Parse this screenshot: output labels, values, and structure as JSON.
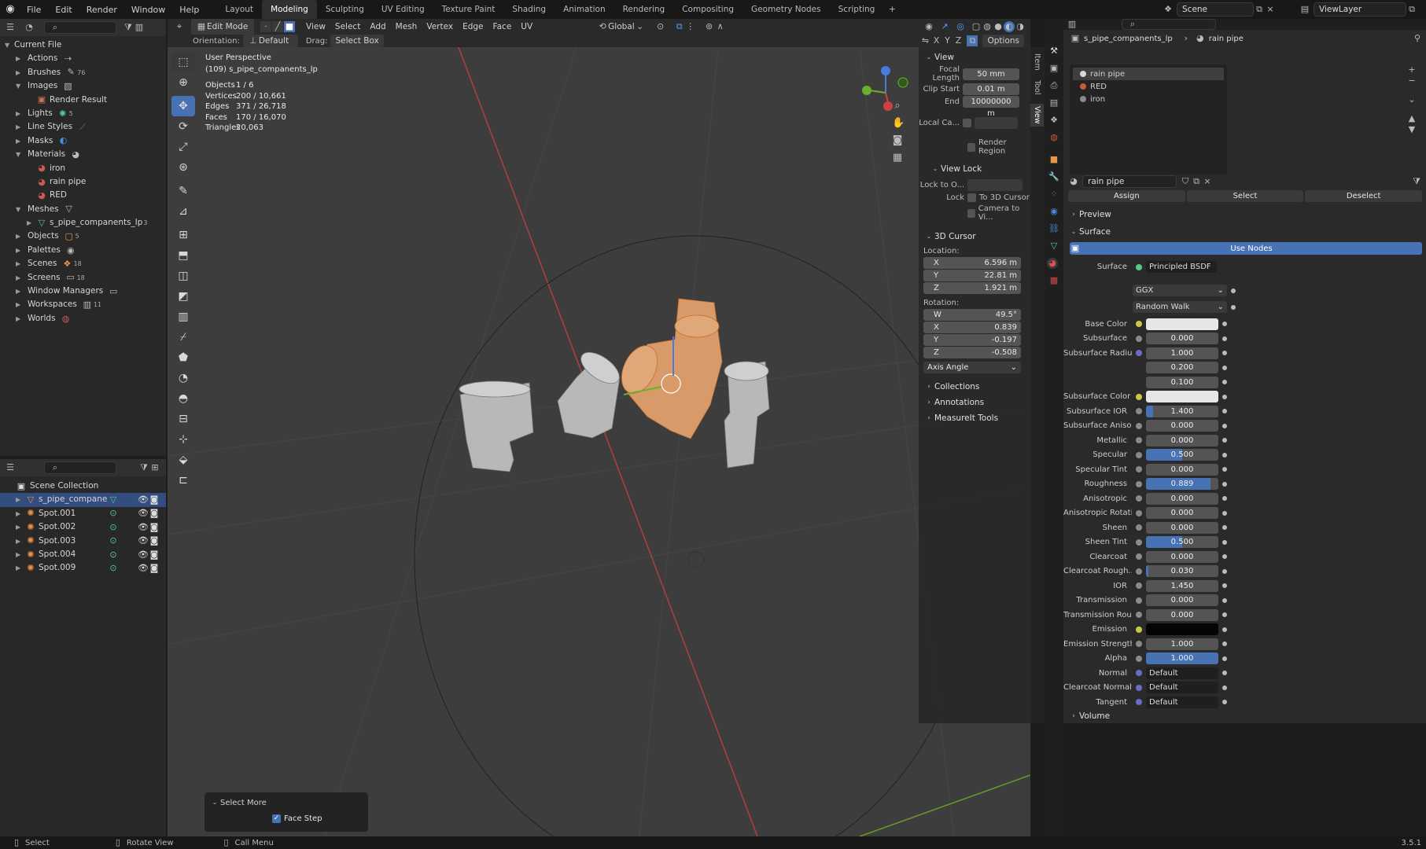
{
  "menu": [
    "File",
    "Edit",
    "Render",
    "Window",
    "Help"
  ],
  "workspaces": [
    {
      "label": "Layout",
      "active": false
    },
    {
      "label": "Modeling",
      "active": true
    },
    {
      "label": "Sculpting",
      "active": false
    },
    {
      "label": "UV Editing",
      "active": false
    },
    {
      "label": "Texture Paint",
      "active": false
    },
    {
      "label": "Shading",
      "active": false
    },
    {
      "label": "Animation",
      "active": false
    },
    {
      "label": "Rendering",
      "active": false
    },
    {
      "label": "Compositing",
      "active": false
    },
    {
      "label": "Geometry Nodes",
      "active": false
    },
    {
      "label": "Scripting",
      "active": false
    }
  ],
  "scene": "Scene",
  "view_layer": "ViewLayer",
  "outliner_top": {
    "root": "Current File",
    "items": [
      {
        "label": "Actions",
        "depth": 1,
        "open": false,
        "badge": ""
      },
      {
        "label": "Brushes",
        "depth": 1,
        "open": false,
        "badge": "76"
      },
      {
        "label": "Images",
        "depth": 1,
        "open": true,
        "badge": ""
      },
      {
        "label": "Render Result",
        "depth": 2,
        "open": null,
        "badge": ""
      },
      {
        "label": "Lights",
        "depth": 1,
        "open": false,
        "badge": "5"
      },
      {
        "label": "Line Styles",
        "depth": 1,
        "open": false,
        "badge": ""
      },
      {
        "label": "Masks",
        "depth": 1,
        "open": false,
        "badge": ""
      },
      {
        "label": "Materials",
        "depth": 1,
        "open": true,
        "badge": ""
      },
      {
        "label": "iron",
        "depth": 2,
        "open": null,
        "badge": ""
      },
      {
        "label": "rain pipe",
        "depth": 2,
        "open": null,
        "badge": ""
      },
      {
        "label": "RED",
        "depth": 2,
        "open": null,
        "badge": ""
      },
      {
        "label": "Meshes",
        "depth": 1,
        "open": true,
        "badge": ""
      },
      {
        "label": "s_pipe_companents_lp",
        "depth": 2,
        "open": false,
        "badge": "3"
      },
      {
        "label": "Objects",
        "depth": 1,
        "open": false,
        "badge": "5"
      },
      {
        "label": "Palettes",
        "depth": 1,
        "open": false,
        "badge": ""
      },
      {
        "label": "Scenes",
        "depth": 1,
        "open": false,
        "badge": "18"
      },
      {
        "label": "Screens",
        "depth": 1,
        "open": false,
        "badge": "18"
      },
      {
        "label": "Window Managers",
        "depth": 1,
        "open": false,
        "badge": ""
      },
      {
        "label": "Workspaces",
        "depth": 1,
        "open": false,
        "badge": "11"
      },
      {
        "label": "Worlds",
        "depth": 1,
        "open": false,
        "badge": ""
      }
    ]
  },
  "outliner_bottom": {
    "root": "Scene Collection",
    "items": [
      {
        "label": "s_pipe_companents_lp",
        "selected": true
      },
      {
        "label": "Spot.001",
        "selected": false
      },
      {
        "label": "Spot.002",
        "selected": false
      },
      {
        "label": "Spot.003",
        "selected": false
      },
      {
        "label": "Spot.004",
        "selected": false
      },
      {
        "label": "Spot.009",
        "selected": false
      }
    ]
  },
  "viewport_header": {
    "mode": "Edit Mode",
    "menus": [
      "View",
      "Select",
      "Add",
      "Mesh",
      "Vertex",
      "Edge",
      "Face",
      "UV"
    ],
    "transform": "Global",
    "orientation_label": "Orientation:",
    "orientation": "Default",
    "drag_label": "Drag:",
    "drag": "Select Box",
    "options": "Options",
    "axes": [
      "X",
      "Y",
      "Z"
    ]
  },
  "overlay_info": {
    "title": "User Perspective",
    "subtitle": "(109) s_pipe_companents_lp",
    "stats": [
      {
        "label": "Objects",
        "value": "1 / 6"
      },
      {
        "label": "Vertices",
        "value": "200 / 10,661"
      },
      {
        "label": "Edges",
        "value": "371 / 26,718"
      },
      {
        "label": "Faces",
        "value": "170 / 16,070"
      },
      {
        "label": "Triangles",
        "value": "20,063"
      }
    ]
  },
  "npanel": {
    "tabs": [
      "Item",
      "Tool",
      "View"
    ],
    "view_section": "View",
    "focal_length_label": "Focal Length",
    "focal_length": "50 mm",
    "clip_start_label": "Clip Start",
    "clip_start": "0.01 m",
    "clip_end_label": "End",
    "clip_end": "10000000 m",
    "local_camera_label": "Local Ca...",
    "render_region": "Render Region",
    "view_lock_section": "View Lock",
    "lock_to_object_label": "Lock to O...",
    "lock_label": "Lock",
    "to_3d_cursor": "To 3D Cursor",
    "camera_to_view": "Camera to Vi...",
    "cursor_section": "3D Cursor",
    "location_label": "Location:",
    "location": [
      {
        "axis": "X",
        "value": "6.596 m"
      },
      {
        "axis": "Y",
        "value": "22.81 m"
      },
      {
        "axis": "Z",
        "value": "1.921 m"
      }
    ],
    "rotation_label": "Rotation:",
    "rotation": [
      {
        "axis": "W",
        "value": "49.5°"
      },
      {
        "axis": "X",
        "value": "0.839"
      },
      {
        "axis": "Y",
        "value": "-0.197"
      },
      {
        "axis": "Z",
        "value": "-0.508"
      }
    ],
    "rotation_mode": "Axis Angle",
    "collapsed": [
      "Collections",
      "Annotations",
      "MeasureIt Tools"
    ]
  },
  "operator_panel": {
    "title": "Select More",
    "option": "Face Step",
    "checked": true
  },
  "properties": {
    "breadcrumb": [
      "s_pipe_companents_lp",
      "rain pipe"
    ],
    "slots": [
      {
        "label": "rain pipe",
        "color": "#d8d8d8",
        "active": true
      },
      {
        "label": "RED",
        "color": "#c85a3a",
        "active": false
      },
      {
        "label": "iron",
        "color": "#8a8a8a",
        "active": false
      }
    ],
    "material_name": "rain pipe",
    "assign": "Assign",
    "select": "Select",
    "deselect": "Deselect",
    "preview": "Preview",
    "surface_section": "Surface",
    "use_nodes": "Use Nodes",
    "surface_label": "Surface",
    "surface_shader": "Principled BSDF",
    "distribution": "GGX",
    "subsurface_method": "Random Walk",
    "fields": [
      {
        "label": "Base Color",
        "kind": "color",
        "color": "#e6e6e6",
        "dot": "#c8c84a"
      },
      {
        "label": "Subsurface",
        "kind": "num",
        "value": "0.000",
        "fill": 0,
        "dot": "#8a8a8a"
      },
      {
        "label": "Subsurface Radius",
        "kind": "num",
        "value": "1.000",
        "fill": 0,
        "dot": "#6a6ac8"
      },
      {
        "label": "",
        "kind": "num",
        "value": "0.200",
        "fill": 0,
        "dot": ""
      },
      {
        "label": "",
        "kind": "num",
        "value": "0.100",
        "fill": 0,
        "dot": ""
      },
      {
        "label": "Subsurface Color",
        "kind": "color",
        "color": "#e6e6e6",
        "dot": "#c8c84a"
      },
      {
        "label": "Subsurface IOR",
        "kind": "num",
        "value": "1.400",
        "fill": 0.1,
        "dot": "#8a8a8a"
      },
      {
        "label": "Subsurface Aniso...",
        "kind": "num",
        "value": "0.000",
        "fill": 0,
        "dot": "#8a8a8a"
      },
      {
        "label": "Metallic",
        "kind": "num",
        "value": "0.000",
        "fill": 0,
        "dot": "#8a8a8a"
      },
      {
        "label": "Specular",
        "kind": "num",
        "value": "0.500",
        "fill": 0.5,
        "dot": "#8a8a8a"
      },
      {
        "label": "Specular Tint",
        "kind": "num",
        "value": "0.000",
        "fill": 0,
        "dot": "#8a8a8a"
      },
      {
        "label": "Roughness",
        "kind": "num",
        "value": "0.889",
        "fill": 0.889,
        "dot": "#8a8a8a"
      },
      {
        "label": "Anisotropic",
        "kind": "num",
        "value": "0.000",
        "fill": 0,
        "dot": "#8a8a8a"
      },
      {
        "label": "Anisotropic Rotation",
        "kind": "num",
        "value": "0.000",
        "fill": 0,
        "dot": "#8a8a8a"
      },
      {
        "label": "Sheen",
        "kind": "num",
        "value": "0.000",
        "fill": 0,
        "dot": "#8a8a8a"
      },
      {
        "label": "Sheen Tint",
        "kind": "num",
        "value": "0.500",
        "fill": 0.5,
        "dot": "#8a8a8a"
      },
      {
        "label": "Clearcoat",
        "kind": "num",
        "value": "0.000",
        "fill": 0,
        "dot": "#8a8a8a"
      },
      {
        "label": "Clearcoat Rough...",
        "kind": "num",
        "value": "0.030",
        "fill": 0.03,
        "dot": "#8a8a8a"
      },
      {
        "label": "IOR",
        "kind": "num",
        "value": "1.450",
        "fill": 0,
        "dot": "#8a8a8a"
      },
      {
        "label": "Transmission",
        "kind": "num",
        "value": "0.000",
        "fill": 0,
        "dot": "#8a8a8a"
      },
      {
        "label": "Transmission Rou...",
        "kind": "num",
        "value": "0.000",
        "fill": 0,
        "dot": "#8a8a8a"
      },
      {
        "label": "Emission",
        "kind": "color",
        "color": "#050505",
        "dot": "#c8c84a"
      },
      {
        "label": "Emission Strength",
        "kind": "num",
        "value": "1.000",
        "fill": 0,
        "dot": "#8a8a8a"
      },
      {
        "label": "Alpha",
        "kind": "num",
        "value": "1.000",
        "fill": 1,
        "dot": "#8a8a8a"
      },
      {
        "label": "Normal",
        "kind": "sel",
        "value": "Default",
        "dot": "#6a6ac8"
      },
      {
        "label": "Clearcoat Normal",
        "kind": "sel",
        "value": "Default",
        "dot": "#6a6ac8"
      },
      {
        "label": "Tangent",
        "kind": "sel",
        "value": "Default",
        "dot": "#6a6ac8"
      }
    ],
    "volume": "Volume"
  },
  "status": {
    "select": "Select",
    "rotate": "Rotate View",
    "menu": "Call Menu",
    "version": "3.5.1"
  },
  "colors": {
    "accent": "#4772b3",
    "selected_object": "#e8a05a"
  }
}
